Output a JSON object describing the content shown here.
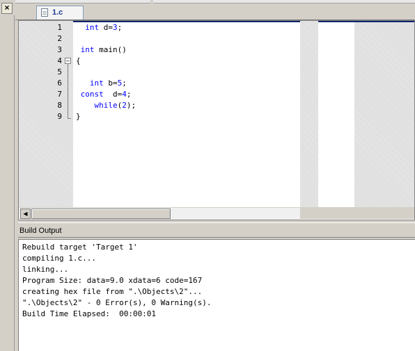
{
  "left_panel": {
    "close_symbol": "×"
  },
  "tab": {
    "label": "1.c",
    "icon": "file-icon"
  },
  "editor": {
    "line_numbers": [
      "1",
      "2",
      "3",
      "4",
      "5",
      "6",
      "7",
      "8",
      "9"
    ],
    "lines": [
      [
        {
          "t": "  int ",
          "c": "kw"
        },
        {
          "t": "d=",
          "c": "plain"
        },
        {
          "t": "3",
          "c": "num"
        },
        {
          "t": ";",
          "c": "plain"
        }
      ],
      [],
      [
        {
          "t": " int ",
          "c": "kw"
        },
        {
          "t": "main()",
          "c": "plain"
        }
      ],
      [
        {
          "t": "{",
          "c": "plain"
        }
      ],
      [],
      [
        {
          "t": "   int ",
          "c": "kw"
        },
        {
          "t": "b=",
          "c": "plain"
        },
        {
          "t": "5",
          "c": "num"
        },
        {
          "t": ";",
          "c": "plain"
        }
      ],
      [
        {
          "t": " const ",
          "c": "kw"
        },
        {
          "t": " d=",
          "c": "plain"
        },
        {
          "t": "4",
          "c": "num"
        },
        {
          "t": ";",
          "c": "plain"
        }
      ],
      [
        {
          "t": "    while",
          "c": "kw"
        },
        {
          "t": "(",
          "c": "plain"
        },
        {
          "t": "2",
          "c": "num"
        },
        {
          "t": ");",
          "c": "plain"
        }
      ],
      [
        {
          "t": "}",
          "c": "plain"
        }
      ]
    ]
  },
  "build_output": {
    "title": "Build Output",
    "lines": [
      "Rebuild target 'Target 1'",
      "compiling 1.c...",
      "linking...",
      "Program Size: data=9.0 xdata=6 code=167",
      "creating hex file from \".\\Objects\\2\"...",
      "\".\\Objects\\2\" - 0 Error(s), 0 Warning(s).",
      "Build Time Elapsed:  00:00:01"
    ]
  }
}
